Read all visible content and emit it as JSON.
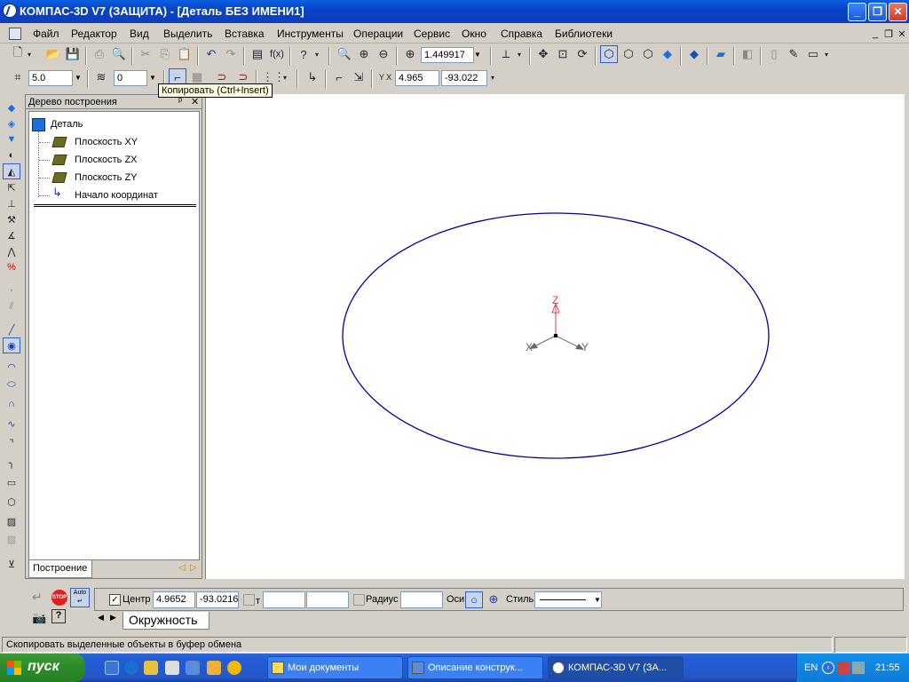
{
  "window": {
    "title": "КОМПАС-3D V7 (ЗАЩИТА) - [Деталь БЕЗ ИМЕНИ1]",
    "minimize_glyph": "_",
    "restore_glyph": "❐",
    "close_glyph": "✕"
  },
  "menu": {
    "items": [
      "Файл",
      "Редактор",
      "Вид",
      "Выделить",
      "Вставка",
      "Инструменты",
      "Операции",
      "Сервис",
      "Окно",
      "Справка",
      "Библиотеки"
    ],
    "doc_minimize": "_",
    "doc_restore": "❐",
    "doc_close": "✕"
  },
  "toolbar": {
    "zoom_value": "1.449917",
    "step_value": "5.0",
    "layer_value": "0",
    "cursor_x": "4.965",
    "cursor_y": "-93.022",
    "function_label": "f(x)",
    "cursor_label": "Y X"
  },
  "tooltip": "Копировать (Ctrl+Insert)",
  "tree": {
    "title": "Дерево построения",
    "pin": "ᵖ",
    "close": "✕",
    "root": "Деталь",
    "nodes": [
      "Плоскость XY",
      "Плоскость ZX",
      "Плоскость ZY",
      "Начало координат"
    ],
    "tab": "Построение"
  },
  "canvas": {
    "axis_z": "Z",
    "axis_x": "X",
    "axis_y": "Y",
    "circle_color": "#0000a0",
    "z_color": "#e04040"
  },
  "params": {
    "center_label": "Центр",
    "center_x": "4.9652",
    "center_y": "-93.0216",
    "t_label": "т",
    "t_value_1": "",
    "t_value_2": "",
    "radius_label": "Радиус",
    "radius_value": "",
    "axes_label": "Оси",
    "style_label": "Стиль",
    "tab_label": "Окружность",
    "center_checked": "✓",
    "auto_label": "Auto",
    "stop_label": "STOP"
  },
  "status": {
    "message": "Скопировать выделенные объекты в буфер обмена"
  },
  "taskbar": {
    "start": "пуск",
    "tasks": [
      "Мои документы",
      "Описание конструк...",
      "КОМПАС-3D V7 (ЗА..."
    ],
    "lang": "EN",
    "clock": "21:55"
  }
}
